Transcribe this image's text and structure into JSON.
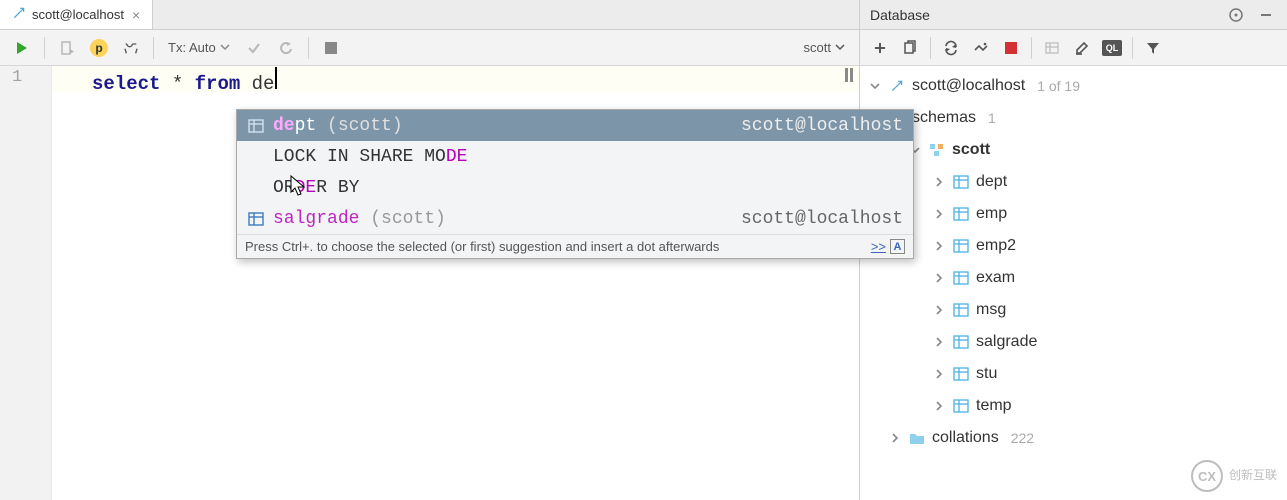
{
  "tab": {
    "title": "scott@localhost"
  },
  "toolbar": {
    "tx_label": "Tx: Auto",
    "schema_label": "scott"
  },
  "editor": {
    "line_number": "1",
    "kw_select": "select",
    "star": "*",
    "kw_from": "from",
    "typed": "de"
  },
  "completion": {
    "rows": [
      {
        "pre": "de",
        "rest": "pt",
        "paren": " (scott)",
        "origin": "scott@localhost",
        "selected": true,
        "icon": "table"
      },
      {
        "text_pre": "LOCK IN SHARE MO",
        "text_hi": "DE",
        "text_post": "",
        "plain": true
      },
      {
        "text_pre": "OR",
        "text_hi": "DE",
        "text_post": "R BY",
        "plain": true
      },
      {
        "pre": "salgra",
        "rest": "de",
        "paren": " (scott)",
        "origin": "scott@localhost",
        "icon": "table",
        "dim": true
      }
    ],
    "hint": "Press Ctrl+. to choose the selected (or first) suggestion and insert a dot afterwards",
    "more": ">>",
    "abox": "A"
  },
  "db": {
    "panel_title": "Database",
    "root": {
      "label": "scott@localhost",
      "meta": "1 of 19"
    },
    "schemas": {
      "label": "schemas",
      "meta": "1"
    },
    "schema": {
      "label": "scott"
    },
    "tables": [
      {
        "label": "dept"
      },
      {
        "label": "emp"
      },
      {
        "label": "emp2"
      },
      {
        "label": "exam"
      },
      {
        "label": "msg"
      },
      {
        "label": "salgrade"
      },
      {
        "label": "stu"
      },
      {
        "label": "temp"
      }
    ],
    "collations": {
      "label": "collations",
      "meta": "222"
    }
  },
  "watermark": {
    "badge": "CX",
    "text": "创新互联"
  }
}
